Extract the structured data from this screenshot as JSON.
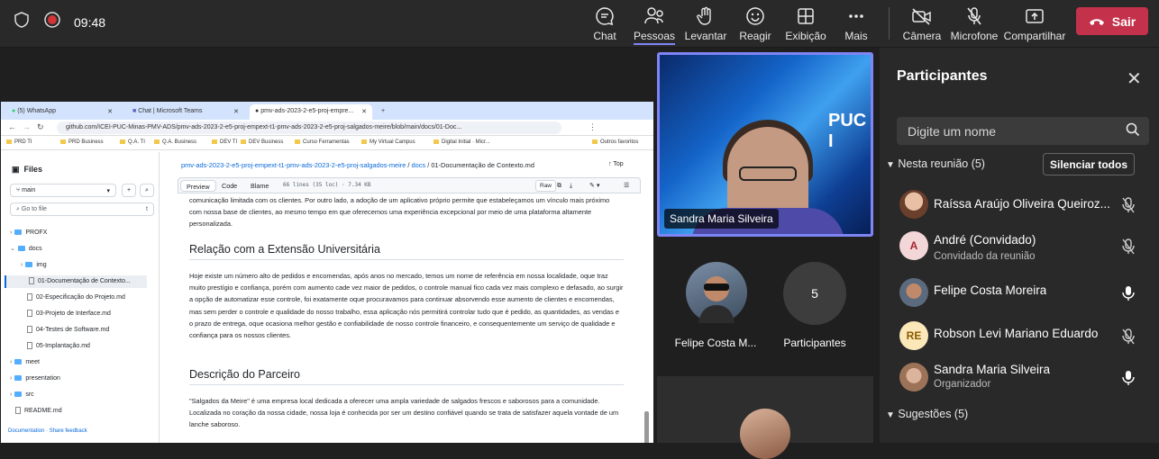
{
  "topbar": {
    "time": "09:48",
    "buttons": [
      {
        "label": "Chat",
        "icon": "chat-icon"
      },
      {
        "label": "Pessoas",
        "icon": "people-icon",
        "active": true
      },
      {
        "label": "Levantar",
        "icon": "raise-hand-icon"
      },
      {
        "label": "Reagir",
        "icon": "react-icon"
      },
      {
        "label": "Exibição",
        "icon": "view-icon"
      },
      {
        "label": "Mais",
        "icon": "more-icon"
      },
      {
        "label": "Câmera",
        "icon": "camera-off-icon"
      },
      {
        "label": "Microfone",
        "icon": "mic-off-icon"
      },
      {
        "label": "Compartilhar",
        "icon": "share-icon"
      }
    ],
    "leave_label": "Sair",
    "leave_color": "#c4314b",
    "accent_color": "#7f85f5"
  },
  "browser": {
    "tabs": [
      "(5) WhatsApp",
      "Chat | Microsoft Teams",
      "pmv-ads-2023-2-e5-proj-empre..."
    ],
    "url": "github.com/ICEI-PUC-Minas-PMV-ADS/pmv-ads-2023-2-e5-proj-empext-t1-pmv-ads-2023-2-e5-proj-salgados-meire/blob/main/docs/01-Doc...",
    "bookmarks": [
      "PRD TI",
      "PRD Business",
      "Q.A. TI",
      "Q.A. Business",
      "DEV TI",
      "DEV Business",
      "Curso Ferramentas",
      "My Virtual Campus",
      "Digital Initial · Micr...",
      "Outros favoritos"
    ]
  },
  "github": {
    "files_label": "Files",
    "branch": "main",
    "go_to_file": "Go to file",
    "tree": [
      {
        "name": "PROFX",
        "type": "folder",
        "level": 0
      },
      {
        "name": "docs",
        "type": "folder",
        "level": 0
      },
      {
        "name": "img",
        "type": "folder",
        "level": 1
      },
      {
        "name": "01-Documentação de Contexto...",
        "type": "file",
        "level": 1,
        "selected": true
      },
      {
        "name": "02-Especificação do Projeto.md",
        "type": "file",
        "level": 1
      },
      {
        "name": "03-Projeto de Interface.md",
        "type": "file",
        "level": 1
      },
      {
        "name": "04-Testes de Software.md",
        "type": "file",
        "level": 1
      },
      {
        "name": "05-Implantação.md",
        "type": "file",
        "level": 1
      },
      {
        "name": "meet",
        "type": "folder",
        "level": 0
      },
      {
        "name": "presentation",
        "type": "folder",
        "level": 0
      },
      {
        "name": "src",
        "type": "folder",
        "level": 0
      },
      {
        "name": "README.md",
        "type": "file",
        "level": 0
      }
    ],
    "footer": "Documentation · Share feedback",
    "breadcrumb_repo": "pmv-ads-2023-2-e5-proj-empext-t1-pmv-ads-2023-2-e5-proj-salgados-meire",
    "breadcrumb_folder": "docs",
    "breadcrumb_file": "01-Documentação de Contexto.md",
    "top_label": "Top",
    "view_tabs": [
      "Preview",
      "Code",
      "Blame"
    ],
    "file_info": "66 lines (35 loc) · 7.34 KB",
    "raw_label": "Raw",
    "para1": "comunicação limitada com os clientes. Por outro lado, a adoção de um aplicativo próprio permite que estabeleçamos um vínculo mais próximo com nossa base de clientes, ao mesmo tempo em que oferecemos uma experiência excepcional por meio de uma plataforma altamente personalizada.",
    "heading1": "Relação com a Extensão Universitária",
    "para2": "Hoje existe um número alto de pedidos e encomendas, após anos no mercado, temos um nome de referência em nossa localidade, oque traz muito prestígio e confiança, porém com aumento cade vez maior de pedidos, o controle manual fico cada vez mais complexo e defasado, ao surgir a opção de automatizar esse controle, foi exatamente oque procuravamos para continuar absorvendo esse aumento de clientes e encomendas, mas sem perder o controle e qualidade do nosso trabalho, essa aplicação nós permitirá controlar tudo que é pedido, as quantidades, as vendas e o prazo de entrega, oque ocasiona melhor gestão e confiabilidade de nosso controle financeiro, e consequentemente um serviço de qualidade e confiança para os nossos clientes.",
    "heading2": "Descrição do Parceiro",
    "para3": "\"Salgados da Meire\" é uma empresa local dedicada a oferecer uma ampla variedade de salgados frescos e saborosos para a comunidade. Localizada no coração da nossa cidade, nossa loja é conhecida por ser um destino confiável quando se trata de satisfazer aquela vontade de um lanche saboroso."
  },
  "video": {
    "main_name": "Sandra Maria Silveira",
    "logo_text": "PUC I",
    "tile1_name": "Felipe Costa M...",
    "tile2_count": "5",
    "tile2_label": "Participantes"
  },
  "panel": {
    "title": "Participantes",
    "search_placeholder": "Digite um nome",
    "section_in_meeting": "Nesta reunião (5)",
    "mute_all": "Silenciar todos",
    "section_suggestions": "Sugestões (5)",
    "people": [
      {
        "name": "Raíssa Araújo Oliveira Queiroz...",
        "sub": "",
        "initials": "",
        "avatar_color": "#8a5a44",
        "mic": "muted"
      },
      {
        "name": "André (Convidado)",
        "sub": "Convidado da reunião",
        "initials": "A",
        "avatar_color": "#f3d6d8",
        "mic": "muted"
      },
      {
        "name": "Felipe Costa Moreira",
        "sub": "",
        "initials": "",
        "avatar_color": "#6d7a8a",
        "mic": "on"
      },
      {
        "name": "Robson Levi Mariano Eduardo",
        "sub": "",
        "initials": "RE",
        "avatar_color": "#fbe7b8",
        "mic": "muted"
      },
      {
        "name": "Sandra Maria Silveira",
        "sub": "Organizador",
        "initials": "",
        "avatar_color": "#b58a6e",
        "mic": "on"
      }
    ]
  }
}
